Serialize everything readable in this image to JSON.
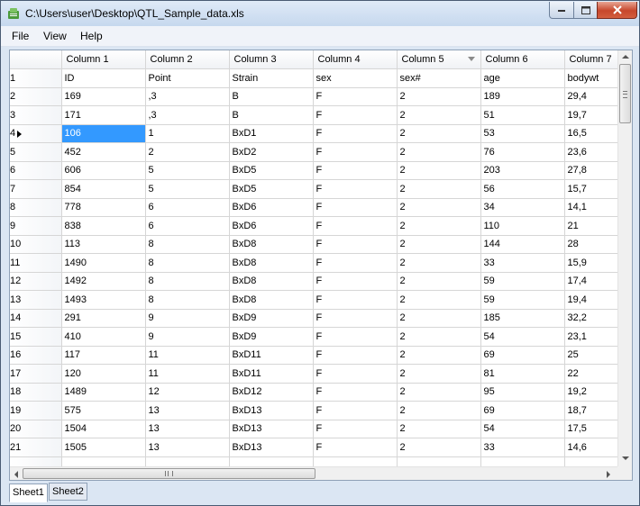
{
  "window": {
    "title": "C:\\Users\\user\\Desktop\\QTL_Sample_data.xls"
  },
  "menu": {
    "file": "File",
    "view": "View",
    "help": "Help"
  },
  "grid": {
    "columns": [
      "Column 1",
      "Column 2",
      "Column 3",
      "Column 4",
      "Column 5",
      "Column 6",
      "Column 7"
    ],
    "selected_row": 4,
    "selected_col": 0,
    "rows": [
      {
        "num": "1",
        "cells": [
          "ID",
          "Point",
          "Strain",
          "sex",
          "sex#",
          "age",
          "bodywt"
        ]
      },
      {
        "num": "2",
        "cells": [
          "169",
          ",3",
          "B",
          "F",
          "2",
          "189",
          "29,4"
        ]
      },
      {
        "num": "3",
        "cells": [
          "171",
          ",3",
          "B",
          "F",
          "2",
          "51",
          "19,7"
        ]
      },
      {
        "num": "4",
        "cells": [
          "106",
          "1",
          "BxD1",
          "F",
          "2",
          "53",
          "16,5"
        ]
      },
      {
        "num": "5",
        "cells": [
          "452",
          "2",
          "BxD2",
          "F",
          "2",
          "76",
          "23,6"
        ]
      },
      {
        "num": "6",
        "cells": [
          "606",
          "5",
          "BxD5",
          "F",
          "2",
          "203",
          "27,8"
        ]
      },
      {
        "num": "7",
        "cells": [
          "854",
          "5",
          "BxD5",
          "F",
          "2",
          "56",
          "15,7"
        ]
      },
      {
        "num": "8",
        "cells": [
          "778",
          "6",
          "BxD6",
          "F",
          "2",
          "34",
          "14,1"
        ]
      },
      {
        "num": "9",
        "cells": [
          "838",
          "6",
          "BxD6",
          "F",
          "2",
          "110",
          "21"
        ]
      },
      {
        "num": "10",
        "cells": [
          "113",
          "8",
          "BxD8",
          "F",
          "2",
          "144",
          "28"
        ]
      },
      {
        "num": "11",
        "cells": [
          "1490",
          "8",
          "BxD8",
          "F",
          "2",
          "33",
          "15,9"
        ]
      },
      {
        "num": "12",
        "cells": [
          "1492",
          "8",
          "BxD8",
          "F",
          "2",
          "59",
          "17,4"
        ]
      },
      {
        "num": "13",
        "cells": [
          "1493",
          "8",
          "BxD8",
          "F",
          "2",
          "59",
          "19,4"
        ]
      },
      {
        "num": "14",
        "cells": [
          "291",
          "9",
          "BxD9",
          "F",
          "2",
          "185",
          "32,2"
        ]
      },
      {
        "num": "15",
        "cells": [
          "410",
          "9",
          "BxD9",
          "F",
          "2",
          "54",
          "23,1"
        ]
      },
      {
        "num": "16",
        "cells": [
          "117",
          "11",
          "BxD11",
          "F",
          "2",
          "69",
          "25"
        ]
      },
      {
        "num": "17",
        "cells": [
          "120",
          "11",
          "BxD11",
          "F",
          "2",
          "81",
          "22"
        ]
      },
      {
        "num": "18",
        "cells": [
          "1489",
          "12",
          "BxD12",
          "F",
          "2",
          "95",
          "19,2"
        ]
      },
      {
        "num": "19",
        "cells": [
          "575",
          "13",
          "BxD13",
          "F",
          "2",
          "69",
          "18,7"
        ]
      },
      {
        "num": "20",
        "cells": [
          "1504",
          "13",
          "BxD13",
          "F",
          "2",
          "54",
          "17,5"
        ]
      },
      {
        "num": "21",
        "cells": [
          "1505",
          "13",
          "BxD13",
          "F",
          "2",
          "33",
          "14,6"
        ]
      },
      {
        "num": "",
        "cells": [
          "",
          "",
          "",
          "",
          "",
          "",
          ""
        ]
      }
    ]
  },
  "sheets": [
    "Sheet1",
    "Sheet2"
  ],
  "active_sheet": "Sheet1",
  "colors": {
    "selection": "#3399ff",
    "close_button": "#c7472c",
    "title_gradient_top": "#dfeaf7"
  }
}
